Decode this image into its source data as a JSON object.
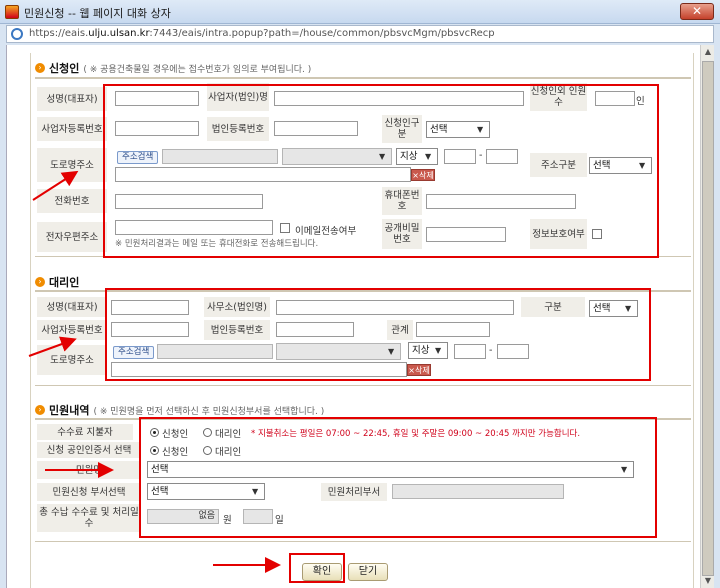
{
  "window": {
    "title": "민원신청 -- 웹 페이지 대화 상자",
    "close": "✕",
    "url_prefix": "https://eais.",
    "url_domain": "ulju.ulsan.kr",
    "url_rest": ":7443/eais/intra.popup?path=/house/common/pbsvcMgm/pbsvcRecp"
  },
  "applicant": {
    "title": "신청인",
    "note": "( ※ 공용건축물일 경우에는 접수번호가 임의로 부여됩니다. )",
    "name_label": "성명(대표자)",
    "office_label": "사업자(법인)명",
    "extra_count_label": "신청인외 인원수",
    "extra_count_unit": "인",
    "bizno_label": "사업자등록번호",
    "corpno_label": "법인등록번호",
    "type_label": "신청인구분",
    "type_value": "선택",
    "road_label": "도로명주소",
    "addr_search": "주소검색",
    "jisang": "지상",
    "dash": "-",
    "delete": "×삭제",
    "addr_type_label": "주소구분",
    "addr_type_value": "선택",
    "phone_label": "전화번호",
    "mobile_label": "휴대폰번호",
    "email_label": "전자우편주소",
    "email_check": "이메일전송여부",
    "email_note": "※ 민원처리결과는 메일 또는 휴대전화로 전송해드립니다.",
    "pw_label": "공개비밀번호",
    "privacy_label": "정보보호여부"
  },
  "agent": {
    "title": "대리인",
    "name_label": "성명(대표자)",
    "office_label": "사무소(법인명)",
    "kind_label": "구분",
    "kind_value": "선택",
    "bizno_label": "사업자등록번호",
    "corpno_label": "법인등록번호",
    "relation_label": "관계",
    "road_label": "도로명주소",
    "addr_search": "주소검색",
    "jisang": "지상",
    "dash": "-",
    "delete": "×삭제"
  },
  "petition": {
    "title": "민원내역",
    "note": "( ※ 민원명을 먼저 선택하신 후 민원신청부서를 선택합니다. )",
    "fee_payer_label": "수수료 지불자",
    "cert_label": "신청 공인인증서 선택",
    "opt_applicant": "신청인",
    "opt_agent": "대리인",
    "warning": "* 지불취소는 평일은 07:00 ~ 22:45, 휴일 및 주말은 09:00 ~ 20:45 까지만 가능합니다.",
    "petition_name_label": "민원명",
    "petition_name_value": "선택",
    "dept_label": "민원신청 부서선택",
    "dept_value": "선택",
    "proc_dept_label": "민원처리부서",
    "total_label": "총 수납 수수료 및 처리일수",
    "amount_value": "없음",
    "won": "원",
    "day": "일"
  },
  "actions": {
    "confirm": "확인",
    "close": "닫기"
  }
}
